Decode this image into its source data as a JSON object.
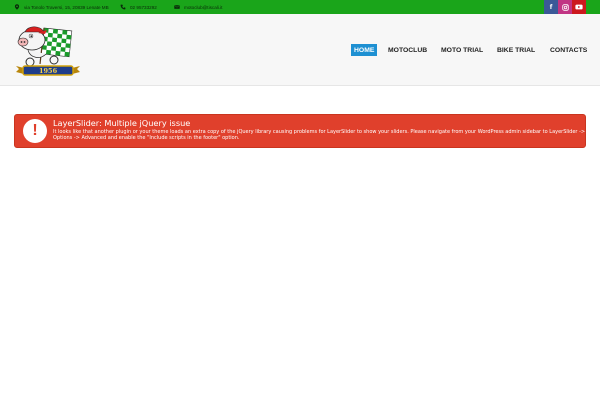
{
  "topbar": {
    "address": "via Tonolo Traversi, 15, 20839 Lenate MB",
    "phone": "02 95733292",
    "email": "motoclub@tiscali.it",
    "social": {
      "facebook": "f",
      "instagram": "◎",
      "youtube": "▶"
    },
    "colors": {
      "bar": "#1aa51a",
      "facebook": "#3b5998",
      "instagram": "#c13584",
      "youtube": "#cc181e"
    }
  },
  "logo": {
    "year": "1956",
    "icon": "pig-mascot-logo"
  },
  "nav": {
    "items": [
      "HOME",
      "MOTOCLUB",
      "MOTO TRIAL",
      "BIKE TRIAL",
      "CONTACTS"
    ],
    "active": "HOME",
    "active_color": "#1e90d2"
  },
  "alert": {
    "icon": "!",
    "title": "LayerSlider: Multiple jQuery issue",
    "message": "It looks like that another plugin or your theme loads an extra copy of the jQuery library causing problems for LayerSlider to show your sliders. Please navigate from your WordPress admin sidebar to LayerSlider -> Options -> Advanced and enable the \"Include scripts in the footer\" option.",
    "color": "#e0402c"
  }
}
